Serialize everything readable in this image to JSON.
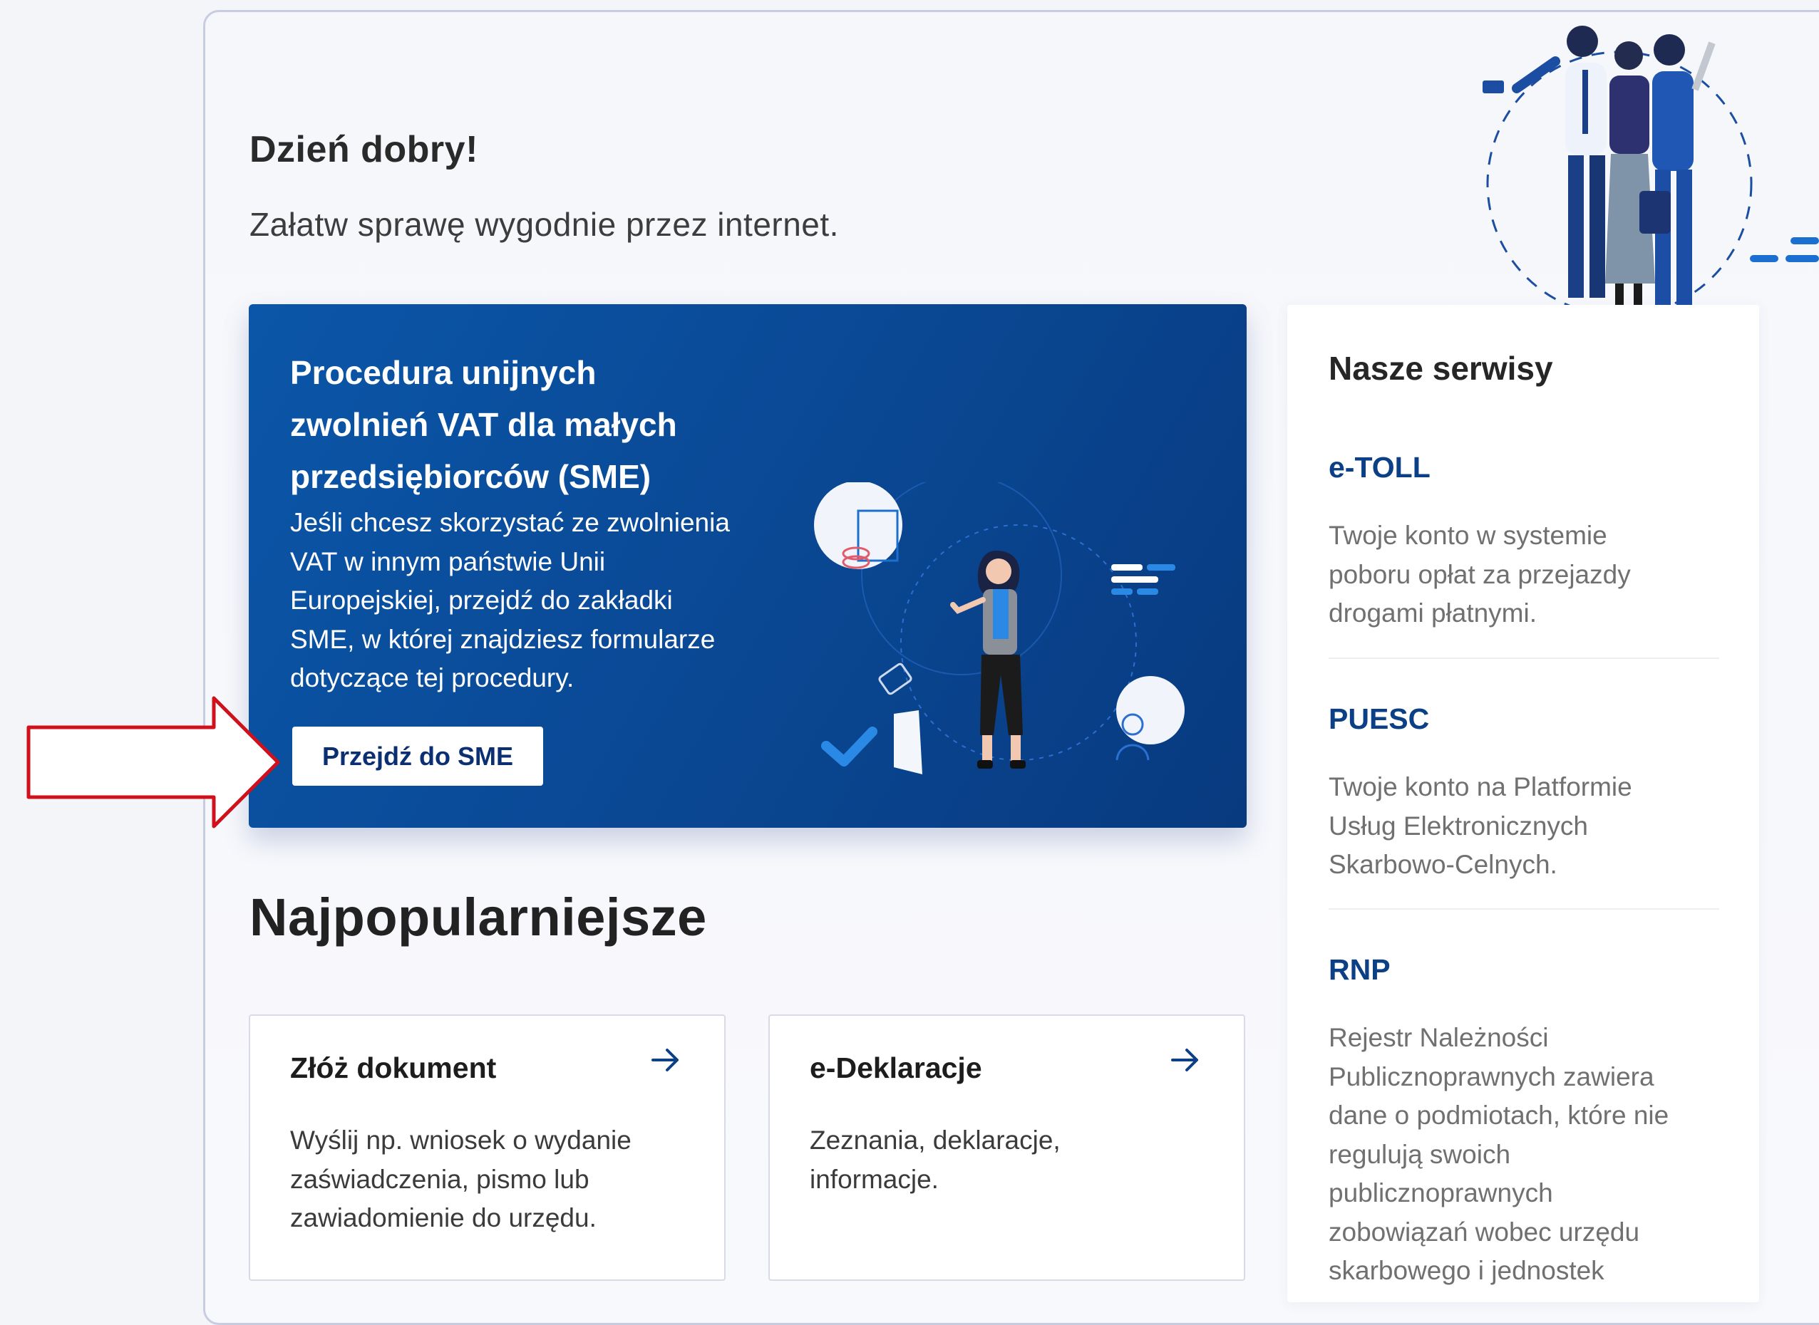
{
  "greeting": "Dzień dobry!",
  "subtitle": "Załatw sprawę wygodnie przez internet.",
  "promo": {
    "title_lines": [
      "Procedura unijnych",
      "zwolnień VAT dla małych",
      "przedsiębiorców (SME)"
    ],
    "text_lines": [
      "Jeśli chcesz skorzystać ze zwolnienia",
      "VAT w innym państwie Unii",
      "Europejskiej, przejdź do zakładki",
      "SME, w której znajdziesz formularze",
      "dotyczące tej procedury."
    ],
    "button_label": "Przejdź do SME"
  },
  "popular": {
    "title": "Najpopularniejsze",
    "cards": [
      {
        "title": "Złóż dokument",
        "desc_lines": [
          "Wyślij np. wniosek o wydanie",
          "zaświadczenia, pismo lub",
          "zawiadomienie do urzędu."
        ]
      },
      {
        "title": "e-Deklaracje",
        "desc_lines": [
          "Zeznania, deklaracje,",
          "informacje."
        ]
      }
    ]
  },
  "services": {
    "title": "Nasze serwisy",
    "items": [
      {
        "name": "e-TOLL",
        "desc_lines": [
          "Twoje konto w systemie",
          "poboru opłat za przejazdy",
          "drogami płatnymi."
        ]
      },
      {
        "name": "PUESC",
        "desc_lines": [
          "Twoje konto na Platformie",
          "Usług Elektronicznych",
          "Skarbowo-Celnych."
        ]
      },
      {
        "name": "RNP",
        "desc_lines": [
          "Rejestr Należności",
          "Publicznoprawnych zawiera",
          "dane o podmiotach, które nie",
          "regulują swoich",
          "publicznoprawnych",
          "zobowiązań wobec urzędu",
          "skarbowego i jednostek"
        ]
      }
    ]
  },
  "colors": {
    "promo_blue": "#0a4a97",
    "link_blue": "#0b3f86",
    "annotation_red": "#d0101b"
  },
  "icons": {
    "card_arrow": "arrow-right-icon",
    "annotation": "red-outline-arrow-icon"
  }
}
